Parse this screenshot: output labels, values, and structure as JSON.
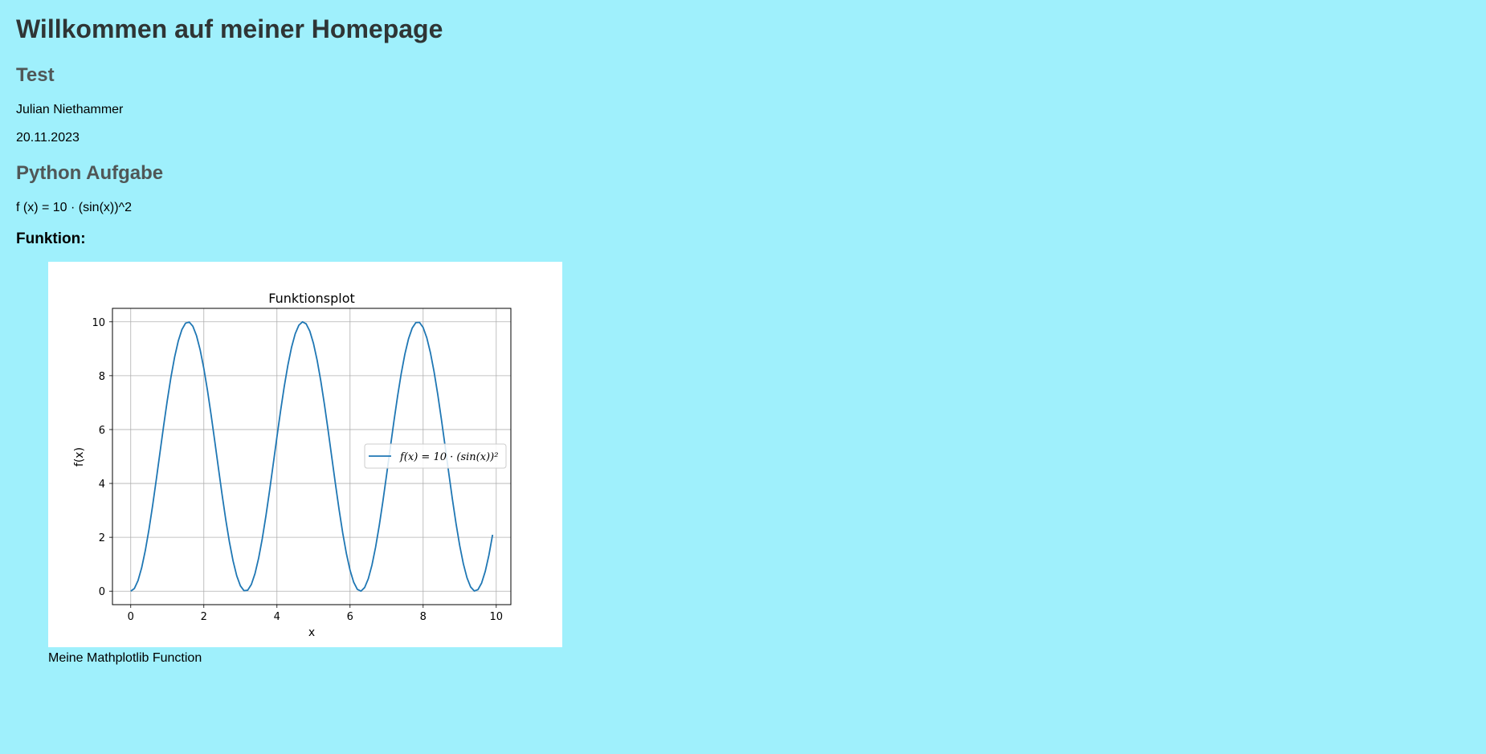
{
  "header": {
    "title": "Willkommen auf meiner Homepage"
  },
  "section_test": {
    "heading": "Test",
    "author": "Julian Niethammer",
    "date": "20.11.2023"
  },
  "section_python": {
    "heading": "Python Aufgabe",
    "formula": "f (x) = 10 · (sin(x))^2",
    "subheading": "Funktion:"
  },
  "figure": {
    "caption": "Meine Mathplotlib Function",
    "background": "#ffffff"
  },
  "colors": {
    "page_background": "#9ff0fc",
    "line": "#1f77b4",
    "grid": "#b0b0b0"
  },
  "chart_data": {
    "type": "line",
    "title": "Funktionsplot",
    "xlabel": "x",
    "ylabel": "f(x)",
    "xlim": [
      -0.5,
      10.4
    ],
    "ylim": [
      -0.5,
      10.5
    ],
    "xticks": [
      0,
      2,
      4,
      6,
      8,
      10
    ],
    "yticks": [
      0,
      2,
      4,
      6,
      8,
      10
    ],
    "grid": true,
    "legend_placement": "center-right",
    "series": [
      {
        "name": "f(x) = 10 · (sin(x))²",
        "function": "10*sin(x)^2",
        "x_start": 0,
        "x_end": 9.9,
        "x_step": 0.1,
        "color": "#1f77b4"
      }
    ]
  }
}
